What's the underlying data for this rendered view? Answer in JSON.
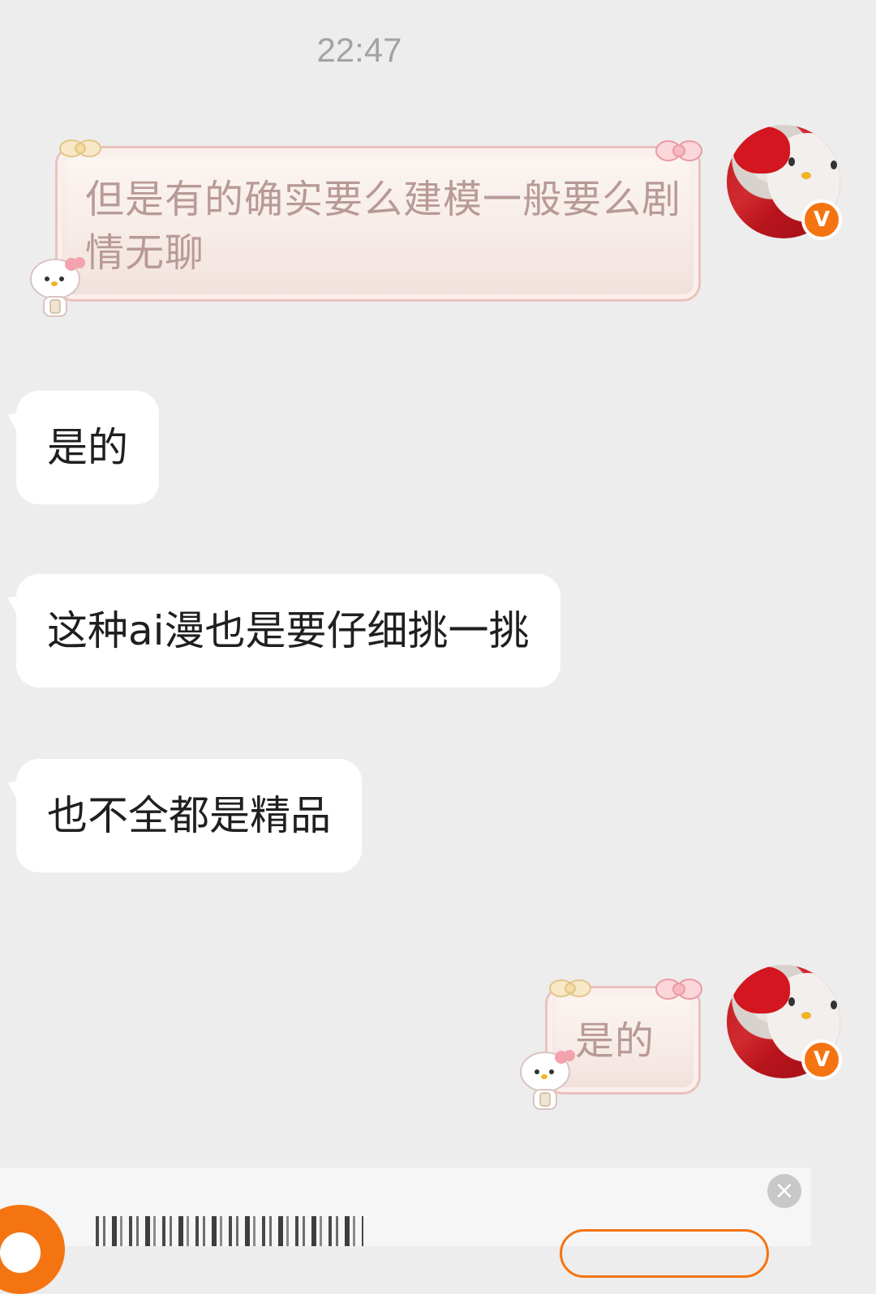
{
  "chat": {
    "time": "22:47",
    "messages": [
      {
        "sender": "me",
        "text": "但是有的确实要么建模一般要么剧情无聊"
      },
      {
        "sender": "other",
        "text": "是的"
      },
      {
        "sender": "other",
        "text": "这种ai漫也是要仔细挑一挑"
      },
      {
        "sender": "other",
        "text": "也不全都是精品"
      },
      {
        "sender": "me",
        "text": "是的"
      }
    ]
  },
  "avatar": {
    "badge_text": "V",
    "badge_color": "#f57412"
  },
  "bottom_bar": {
    "close_icon": "×"
  },
  "colors": {
    "background": "#ededed",
    "other_bubble": "#ffffff",
    "self_bubble_text": "#b89a97",
    "accent": "#f57412"
  }
}
